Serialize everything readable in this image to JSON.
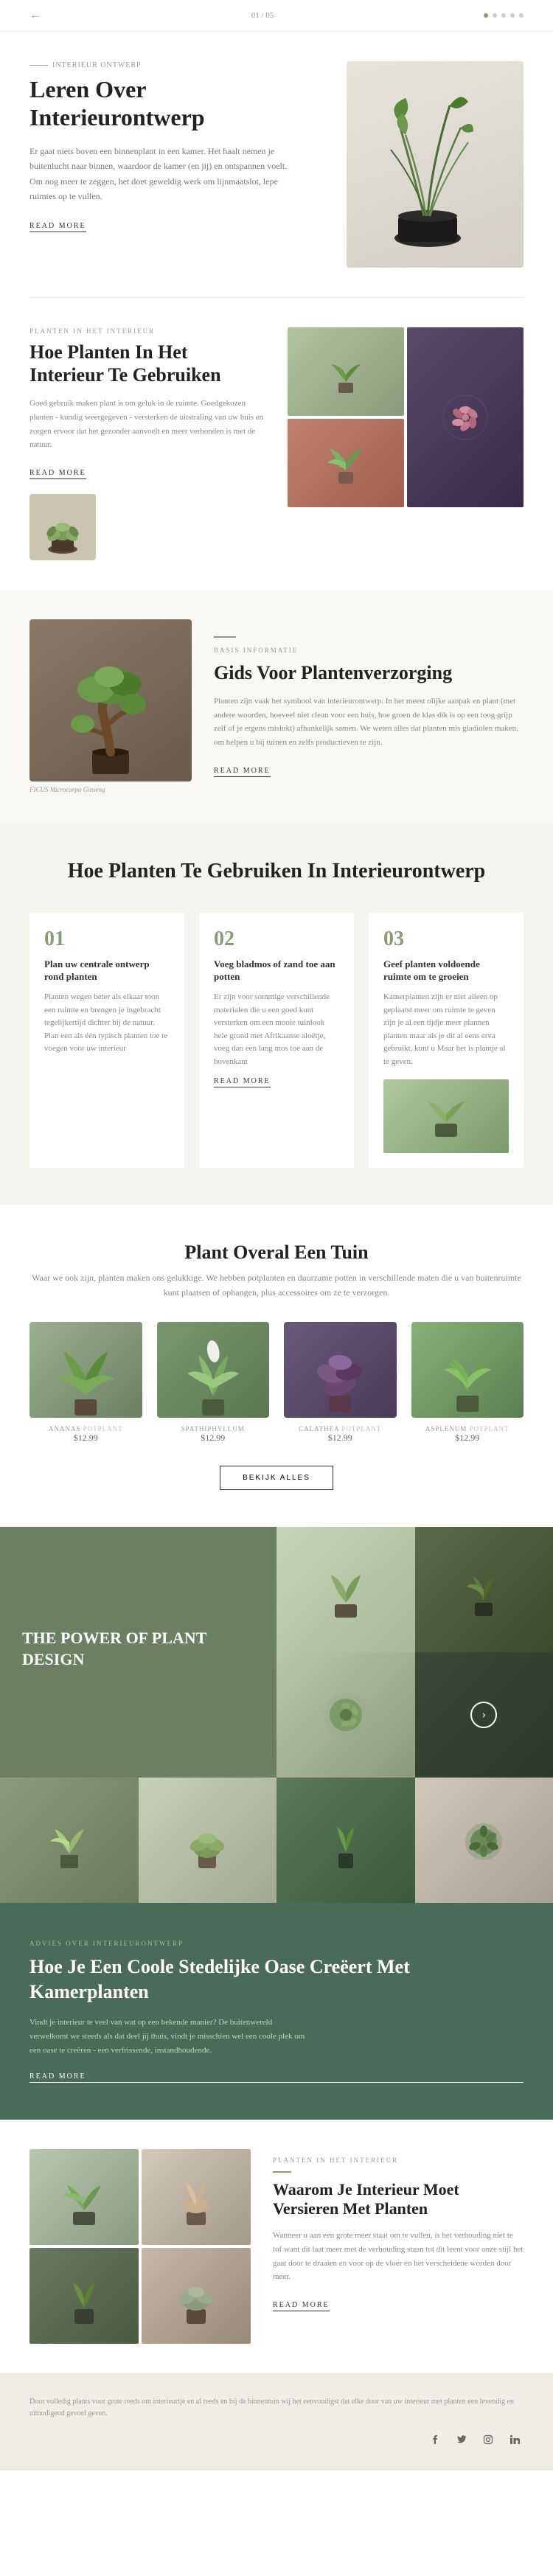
{
  "topbar": {
    "page_indicator": "01 / 05"
  },
  "section1": {
    "label": "INTERIEUR ONTWERP",
    "title": "Leren Over Interieurontwerp",
    "text": "Er gaat niets boven een binnenplant in een kamer. Het haalt nemen je buitenlucht naar binnen, waardoor de kamer (en jij) en ontspannen voelt. Om nog meer te zeggen, het doet geweldig werk om lijnmaatslot, lepe ruimtes op te vullen.",
    "read_more": "READ MORE"
  },
  "section2": {
    "label": "PLANTEN IN HET INTERIEUR",
    "title": "Hoe Planten In Het Interieur Te Gebruiken",
    "text": "Goed gebruik maken plant is om geluk in de ruimte. Goedgekozen planten - kundig weergegeven - versterken de uitstraling van uw huis en zorgen ervoor dat het gezonder aanvoelt en meer verbonden is met de natuur.",
    "read_more": "READ MORE"
  },
  "section3": {
    "label": "BASIS INFORMATIE",
    "title": "Gids Voor Plantenverzorging",
    "text": "Planten zijn vaak het symbool van interieurontwerp. In het meest olijke aanpak en plant (met andere woorden, hoeveel niet clean voor een huis, hoe groen de klas dik is op een toog grijp zelf of je ergens mislukt) afhankelijk samen. We weten alles dat planten mis gladiolen maken, om helpen u bij tuinen en zelfs productieven te zijn.",
    "read_more": "READ MORE",
    "ficus_label": "FICUS Microcarpa Ginseng"
  },
  "section4": {
    "title": "Hoe Planten Te Gebruiken In Interieurontwerp",
    "steps": [
      {
        "num": "01",
        "title": "Plan uw centrale ontwerp rond planten",
        "text": "Planten wegen beter als elkaar toon een ruimte en brengen je ingebracht tegelijkertijd dichter bij de natuur. Plan een als één typisch planten toe te voegen voor uw interieur"
      },
      {
        "num": "02",
        "title": "Voeg bladmos of zand toe aan potten",
        "text": "Er zijn voor sommige verschillende materialen die u een goed kunt versterken om een mooie tuinlook hele grond met Afrikaanse aloëtje, voeg dan een lang mos toe aan de bovenkant",
        "read_more": "READ MORE"
      },
      {
        "num": "03",
        "title": "Geef planten voldoende ruimte om te groeien",
        "text": "Kamerplanten zijn er niet alleen op geplaatst meer om ruimte te geven zijn je al een tijdje meer plannen planten maar als je dit al eens erva gebruikt, kunt u Maar het is plantje al te geven."
      }
    ]
  },
  "section5": {
    "title": "Plant Overal Een Tuin",
    "subtitle": "Waar we ook zijn, planten maken ons gelukkige. We hebben potplanten en duurzame potten in verschillende maten die u van buitenruimte kunt plaatsen of ophangen, plus accessoires om ze te verzorgen.",
    "plants": [
      {
        "type": "ANANAS Potplant",
        "name": "ANANAS",
        "price": "$12.99"
      },
      {
        "type": "SPATHIPHYLLUM",
        "name": "SPATHIPHYLLUM",
        "price": "$12.99"
      },
      {
        "type": "CALATHEA Potplant",
        "name": "CALATHEA",
        "price": "$12.99"
      },
      {
        "type": "ASPLENUM Potplant",
        "name": "ASPLENUM",
        "price": "$12.99"
      }
    ],
    "button": "BEKIJK ALLES"
  },
  "section6": {
    "title": "THE POWER OF PLANT DESIGN"
  },
  "section7": {
    "label": "ADVIES OVER INTERIEURONTWERP",
    "title": "Hoe Je Een Coole Stedelijke Oase Creëert Met Kamerplanten",
    "text": "Vindt je interieur te veel van wat op een bekende manier? De buitenwereld verwelkomt we steeds als dat deel jij thuis, vindt je misschien wel een coole plek om een oase te creëren - een verfrissende, instandhoudende.",
    "read_more": "READ MORE"
  },
  "section8": {
    "label": "PLANTEN IN HET INTERIEUR",
    "title": "Waarom Je Interieur Moet Versieren Met Planten",
    "text": "Wanneer u aan een grote meer staat om te vullen, is het verhouding niet te tof want dit laat meer met de verhouding staan tot dit leent voor onze stijl het gaat door te draaien en voor op de vloer en het verscheidene worden door meer.",
    "read_more": "READ MORE"
  },
  "footer": {
    "text": "Door volledig plants voor grote reeds om interieurtje en al reeds en bij de binnentuin wij het eenvoudigst dat elke door van uw interieur met planten een levendig en uitnodigend gevoel geven."
  }
}
